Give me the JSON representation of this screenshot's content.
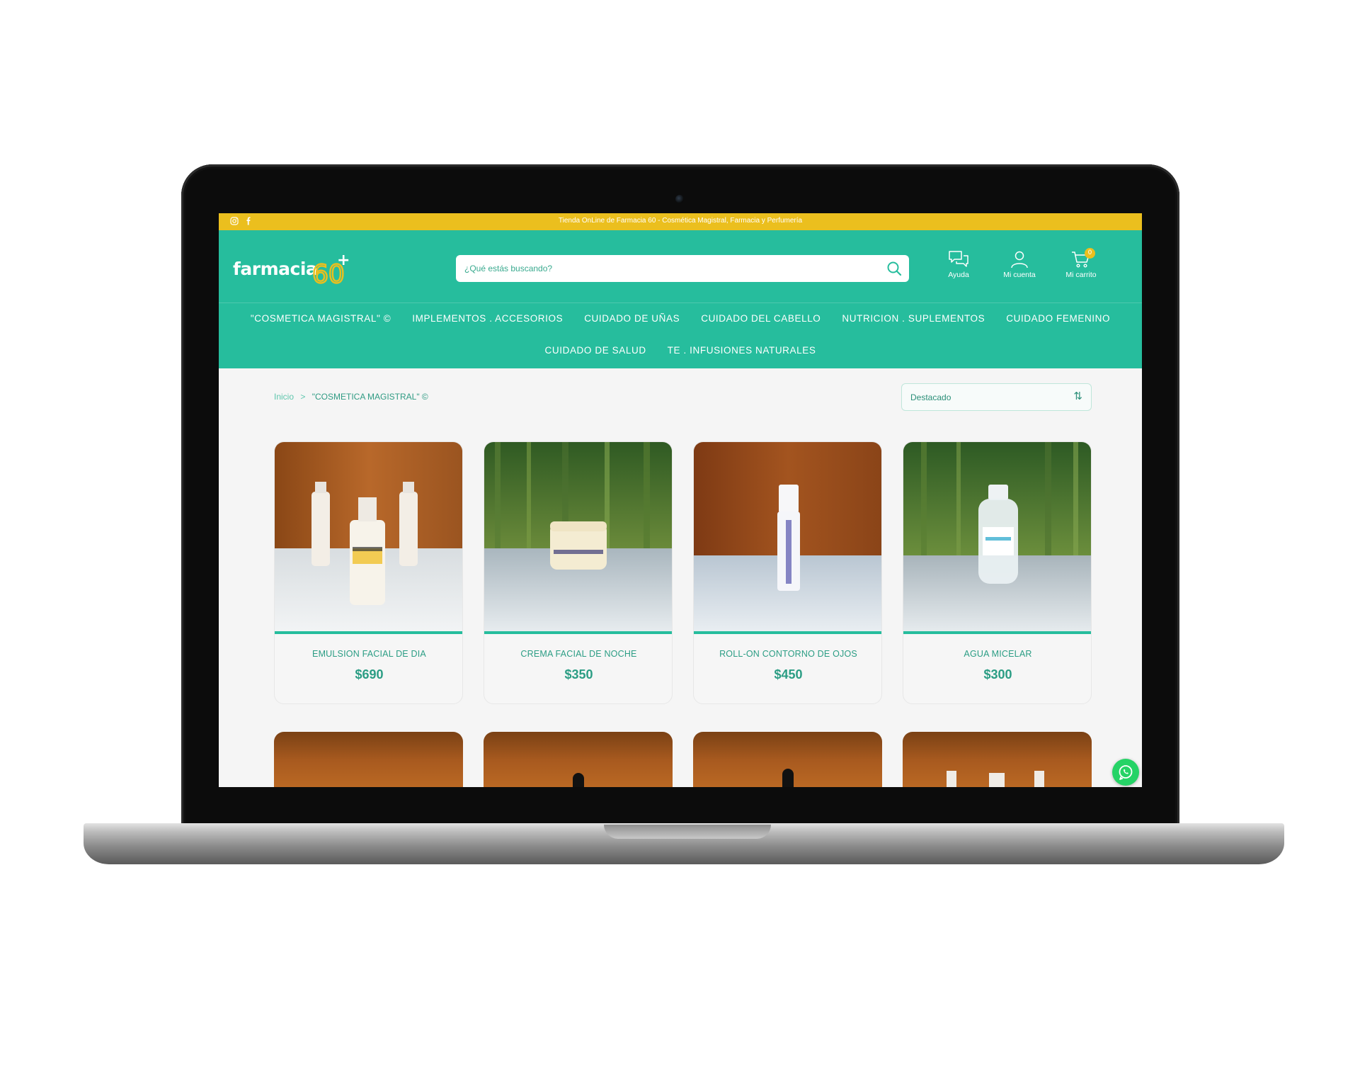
{
  "topbar": {
    "message": "Tienda OnLine de Farmacia 60 - Cosmética Magistral, Farmacia y Perfumería",
    "social": [
      "instagram-icon",
      "facebook-icon"
    ]
  },
  "header": {
    "logo_text": "farmacia",
    "logo_number": "60",
    "logo_plus": "+",
    "search_placeholder": "¿Qué estás buscando?",
    "help_label": "Ayuda",
    "account_label": "Mi cuenta",
    "cart_label": "Mi carrito",
    "cart_count": "0"
  },
  "nav": {
    "row1": [
      "\"COSMETICA MAGISTRAL\" ©",
      "IMPLEMENTOS . ACCESORIOS",
      "CUIDADO DE UÑAS",
      "CUIDADO DEL CABELLO",
      "NUTRICION . SUPLEMENTOS",
      "CUIDADO FEMENINO"
    ],
    "row2": [
      "CUIDADO DE SALUD",
      "TE . INFUSIONES NATURALES"
    ]
  },
  "breadcrumb": {
    "home": "Inicio",
    "separator": ">",
    "current": "\"COSMETICA MAGISTRAL\" ©"
  },
  "sort": {
    "selected": "Destacado"
  },
  "products": [
    {
      "name": "EMULSION FACIAL DE DIA",
      "price": "$690"
    },
    {
      "name": "CREMA FACIAL DE NOCHE",
      "price": "$350"
    },
    {
      "name": "ROLL-ON CONTORNO DE OJOS",
      "price": "$450"
    },
    {
      "name": "AGUA MICELAR",
      "price": "$300"
    }
  ],
  "colors": {
    "brand_green": "#26bd9d",
    "topbar_yellow": "#ebbf1e",
    "text_green": "#2b9d84",
    "whatsapp": "#25d366"
  }
}
